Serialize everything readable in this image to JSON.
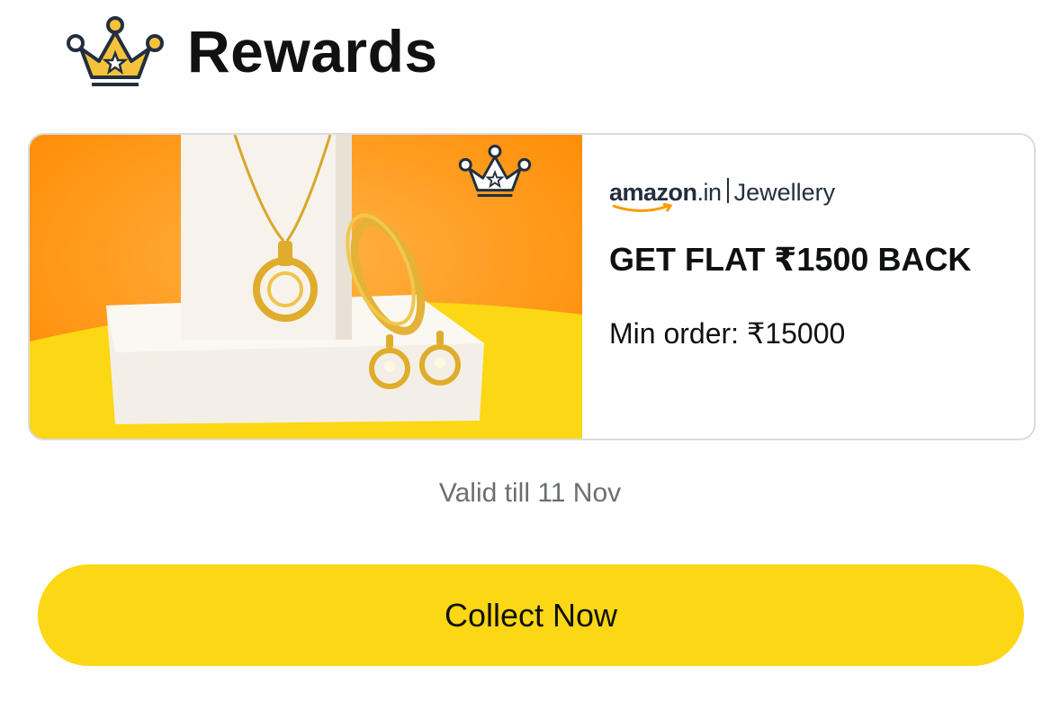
{
  "header": {
    "title": "Rewards",
    "icon": "crown-icon"
  },
  "offer": {
    "brand": {
      "logo": "amazon",
      "logo_suffix": ".in",
      "category": "Jewellery"
    },
    "headline": "GET FLAT ₹1500 BACK",
    "min_order": "Min order: ₹15000",
    "image_badge_icon": "crown-icon"
  },
  "validity": "Valid till 11 Nov",
  "collect_button": {
    "label": "Collect Now"
  },
  "colors": {
    "button": "#fcd714",
    "banner_orange": "#ff8c00",
    "banner_yellow": "#fcd714",
    "crown_gold": "#f5c33b",
    "crown_navy": "#232f3e"
  }
}
